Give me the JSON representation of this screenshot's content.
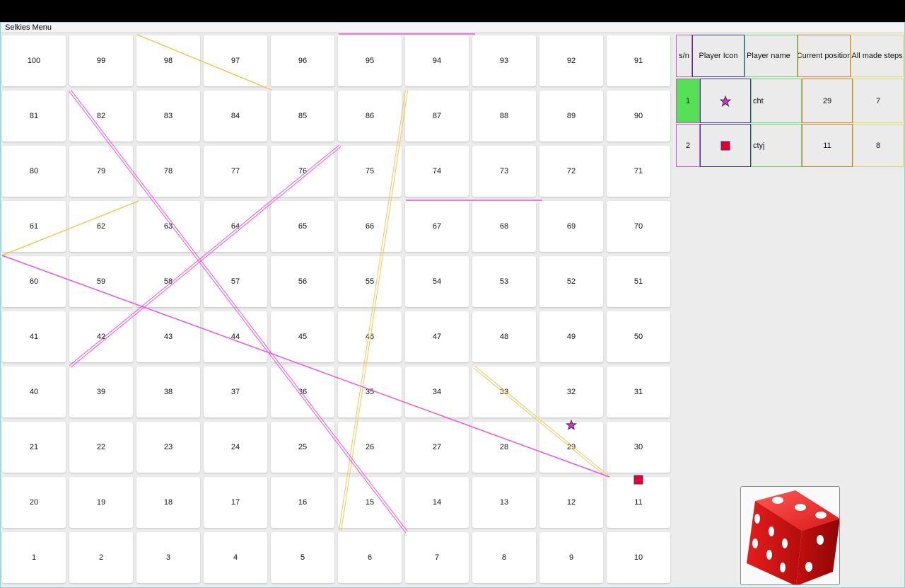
{
  "window": {
    "menu_title": "Selkies Menu"
  },
  "board": {
    "rows": [
      [
        100,
        99,
        98,
        97,
        96,
        95,
        94,
        93,
        92,
        91
      ],
      [
        81,
        82,
        83,
        84,
        85,
        86,
        87,
        88,
        89,
        90
      ],
      [
        80,
        79,
        78,
        77,
        76,
        75,
        74,
        73,
        72,
        71
      ],
      [
        61,
        62,
        63,
        64,
        65,
        66,
        67,
        68,
        69,
        70
      ],
      [
        60,
        59,
        58,
        57,
        56,
        55,
        54,
        53,
        52,
        51
      ],
      [
        41,
        42,
        43,
        44,
        45,
        46,
        47,
        48,
        49,
        50
      ],
      [
        40,
        39,
        38,
        37,
        36,
        35,
        34,
        33,
        32,
        31
      ],
      [
        21,
        22,
        23,
        24,
        25,
        26,
        27,
        28,
        29,
        30
      ],
      [
        20,
        19,
        18,
        17,
        16,
        15,
        14,
        13,
        12,
        11
      ],
      [
        1,
        2,
        3,
        4,
        5,
        6,
        7,
        8,
        9,
        10
      ]
    ],
    "ladder_color": "#f5c658",
    "snake_color": "#ee55dd"
  },
  "players_table": {
    "headers": {
      "sn": "s/n",
      "icon": "Player Icon",
      "name": "Player name",
      "position": "Current position",
      "steps": "All made steps"
    },
    "rows": [
      {
        "sn": "1",
        "icon": "star-icon",
        "name": "cht",
        "position": "29",
        "steps": "7",
        "active": true
      },
      {
        "sn": "2",
        "icon": "square-icon",
        "name": "ctyj",
        "position": "11",
        "steps": "8",
        "active": false
      }
    ]
  },
  "tokens": [
    {
      "player": "1",
      "icon": "star-icon",
      "cell": 29,
      "color": "#cc33cc"
    },
    {
      "player": "2",
      "icon": "square-icon",
      "cell": 11,
      "color": "#e8002a"
    }
  ],
  "dice": {
    "value": 5,
    "color": "#d8161a"
  }
}
